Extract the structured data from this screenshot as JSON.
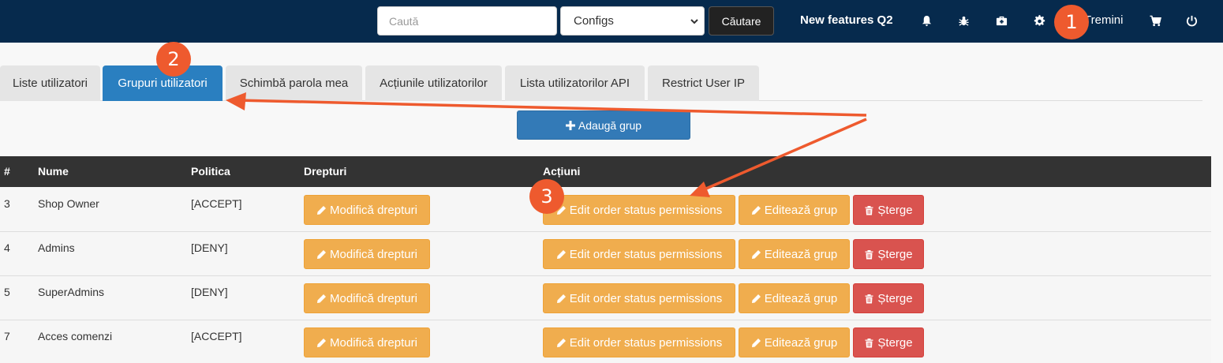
{
  "navbar": {
    "search_placeholder": "Caută",
    "configs_value": "Configs",
    "search_button": "Căutare",
    "new_features": "New features Q2",
    "user_link": "Tremini",
    "icons": [
      "bell-icon",
      "bug-icon",
      "medkit-icon",
      "gear-icon",
      "cart-icon",
      "power-icon"
    ]
  },
  "tabs": [
    {
      "label": "Liste utilizatori",
      "active": false
    },
    {
      "label": "Grupuri utilizatori",
      "active": true
    },
    {
      "label": "Schimbă parola mea",
      "active": false
    },
    {
      "label": "Acțiunile utilizatorilor",
      "active": false
    },
    {
      "label": "Lista utilizatorilor API",
      "active": false
    },
    {
      "label": "Restrict User IP",
      "active": false
    }
  ],
  "add_group_button": "Adaugă grup",
  "table": {
    "headers": {
      "id": "#",
      "name": "Nume",
      "policy": "Politica",
      "rights": "Drepturi",
      "actions": "Acțiuni"
    },
    "rows": [
      {
        "id": "3",
        "name": "Shop Owner",
        "policy": "[ACCEPT]"
      },
      {
        "id": "4",
        "name": "Admins",
        "policy": "[DENY]"
      },
      {
        "id": "5",
        "name": "SuperAdmins",
        "policy": "[DENY]"
      },
      {
        "id": "7",
        "name": "Acces comenzi",
        "policy": "[ACCEPT]"
      }
    ],
    "buttons": {
      "modify_rights": "Modifică drepturi",
      "edit_order_status": "Edit order status permissions",
      "edit_group": "Editează grup",
      "delete": "Șterge"
    }
  },
  "annotations": {
    "badges": [
      "1",
      "2",
      "3"
    ],
    "color": "#ee5a2e"
  },
  "colors": {
    "navbar": "#062a4d",
    "tab_active": "#2a7fc0",
    "primary": "#337ab7",
    "warning": "#f0ad4e",
    "danger": "#d9534f",
    "table_header": "#333333"
  }
}
